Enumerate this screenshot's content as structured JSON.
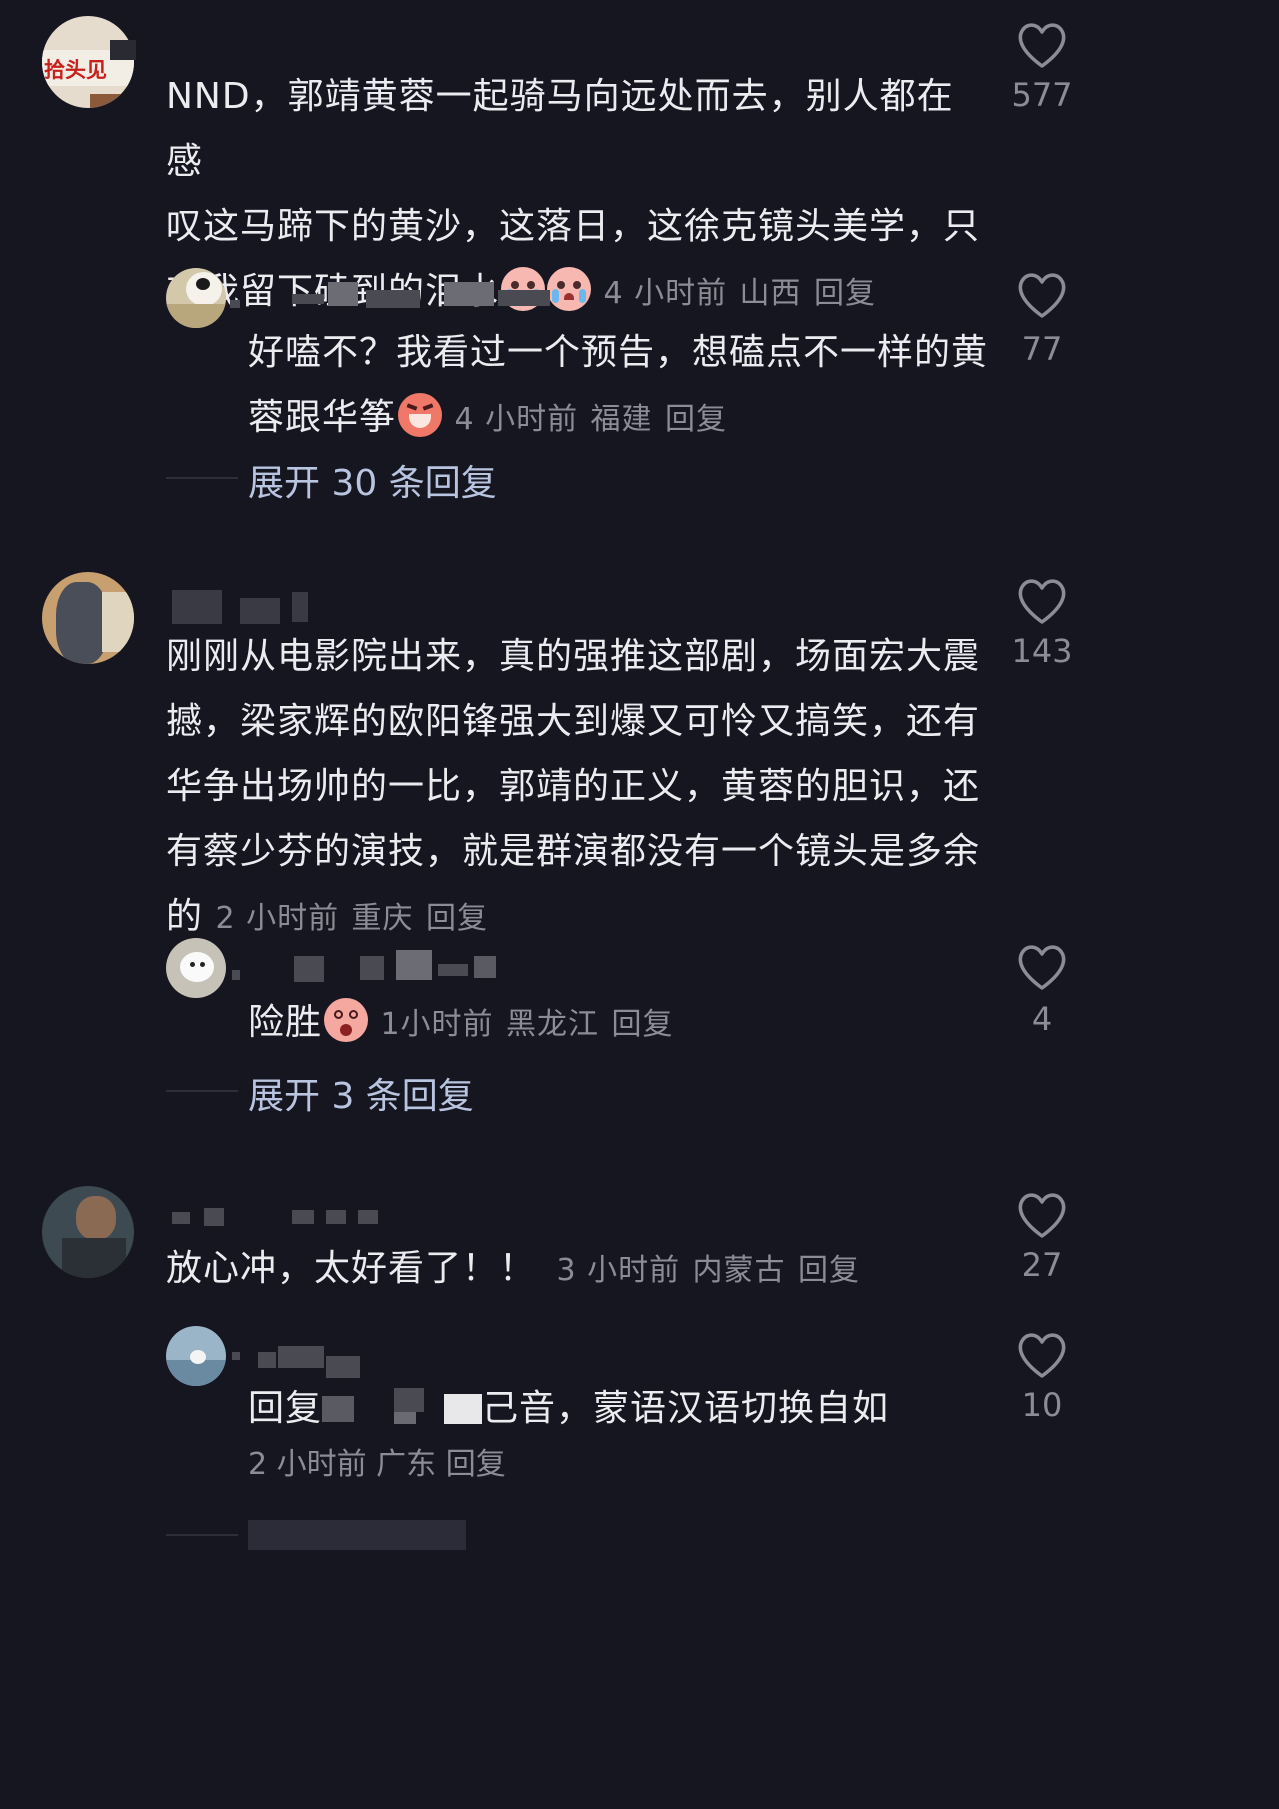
{
  "comments": [
    {
      "avatar_label": "拾头见",
      "text": "NND，郭靖黄蓉一起骑马向远处而去，别人都在感叹这马蹄下的黄沙，这落日，这徐克镜头美学，只有我留下磕到的泪水",
      "line1": "NND，郭靖黄蓉一起骑马向远处而去，别人都在感",
      "line2": "叹这马蹄下的黄沙，这落日，这徐克镜头美学，只",
      "line3": "有我留下磕到的泪水",
      "emoji": "crying-emoji",
      "time": "4 小时前",
      "location": "山西",
      "reply_label": "回复",
      "likes": "577",
      "replies": [
        {
          "line1": "好嗑不？我看过一个预告，想磕点不一样的黄",
          "line2": "蓉跟华筝",
          "emoji": "laughing-emoji",
          "time": "4 小时前",
          "location": "福建",
          "reply_label": "回复",
          "likes": "77"
        }
      ],
      "expand_label": "展开 30 条回复"
    },
    {
      "line1": "刚刚从电影院出来，真的强推这部剧，场面宏大震",
      "line2": "撼，梁家辉的欧阳锋强大到爆又可怜又搞笑，还有",
      "line3": "华争出场帅的一比，郭靖的正义，黄蓉的胆识，还",
      "line4": "有蔡少芬的演技，就是群演都没有一个镜头是多余",
      "line5": "的",
      "time": "2 小时前",
      "location": "重庆",
      "reply_label": "回复",
      "likes": "143",
      "replies": [
        {
          "line1": "险胜",
          "emoji": "nervous-emoji",
          "time": "1小时前",
          "location": "黑龙江",
          "reply_label": "回复",
          "likes": "4"
        }
      ],
      "expand_label": "展开 3 条回复"
    },
    {
      "line1": "放心冲，太好看了！！",
      "time": "3 小时前",
      "location": "内蒙古",
      "reply_label": "回复",
      "likes": "27",
      "replies": [
        {
          "prefix": "回复",
          "suffix": "己音，蒙语汉语切换自如",
          "time": "2 小时前",
          "location": "广东",
          "reply_label": "回复",
          "likes": "10"
        }
      ]
    }
  ],
  "icons": {
    "like": "heart-outline-icon"
  },
  "colors": {
    "background": "#161620",
    "text": "#ececf0",
    "meta": "#8c8c96",
    "expand": "#b8c4e0"
  }
}
